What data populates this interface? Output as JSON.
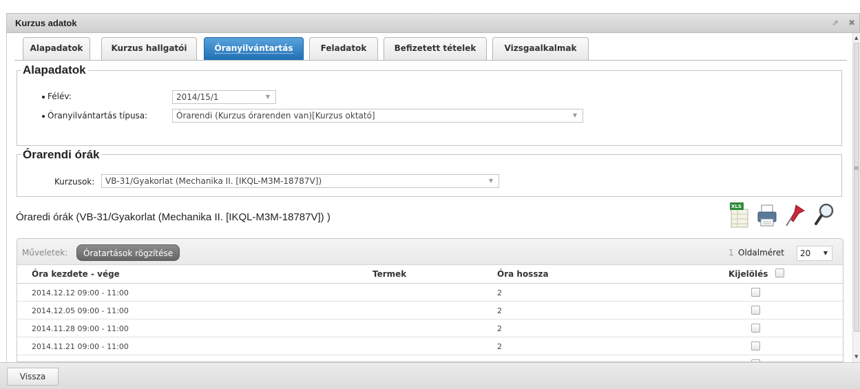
{
  "window": {
    "title": "Kurzus adatok",
    "popout_icon": "popout-icon",
    "close_icon": "close-icon"
  },
  "tabs": [
    {
      "label": "Alapadatok",
      "active": false
    },
    {
      "label": "Kurzus hallgatói",
      "active": false
    },
    {
      "label": "Óranyilvántartás",
      "active": true
    },
    {
      "label": "Feladatok",
      "active": false
    },
    {
      "label": "Befizetett tételek",
      "active": false
    },
    {
      "label": "Vizsgaalkalmak",
      "active": false
    }
  ],
  "alapadatok": {
    "legend": "Alapadatok",
    "felev_label": "Félév:",
    "felev_value": "2014/15/1",
    "tipus_label": "Óranyilvántartás típusa:",
    "tipus_value": "Órarendi (Kurzus órarenden van)[Kurzus oktató]"
  },
  "orarendi": {
    "legend": "Órarendi órák",
    "kurzusok_label": "Kurzusok:",
    "kurzusok_value": "VB-31/Gyakorlat (Mechanika II. [IKQL-M3M-18787V])"
  },
  "section_title": "Óraredi órák (VB-31/Gyakorlat (Mechanika II. [IKQL-M3M-18787V]) )",
  "toolbar_icons": [
    "xls-export-icon",
    "print-icon",
    "pin-icon",
    "search-icon"
  ],
  "grid": {
    "operations_label": "Műveletek:",
    "record_button": "Óratartások rögzítése",
    "page_number": "1",
    "page_size_label": "Oldalméret",
    "page_size_value": "20",
    "columns": {
      "start_end": "Óra kezdete - vége",
      "rooms": "Termek",
      "length": "Óra hossza",
      "select": "Kijelölés"
    },
    "rows": [
      {
        "time": "2014.12.12 09:00 - 11:00",
        "rooms": "",
        "length": "2"
      },
      {
        "time": "2014.12.05 09:00 - 11:00",
        "rooms": "",
        "length": "2"
      },
      {
        "time": "2014.11.28 09:00 - 11:00",
        "rooms": "",
        "length": "2"
      },
      {
        "time": "2014.11.21 09:00 - 11:00",
        "rooms": "",
        "length": "2"
      }
    ]
  },
  "footer": {
    "back_button": "Vissza"
  },
  "colors": {
    "active_tab": "#1f6fb5",
    "dark_button": "#777777"
  }
}
